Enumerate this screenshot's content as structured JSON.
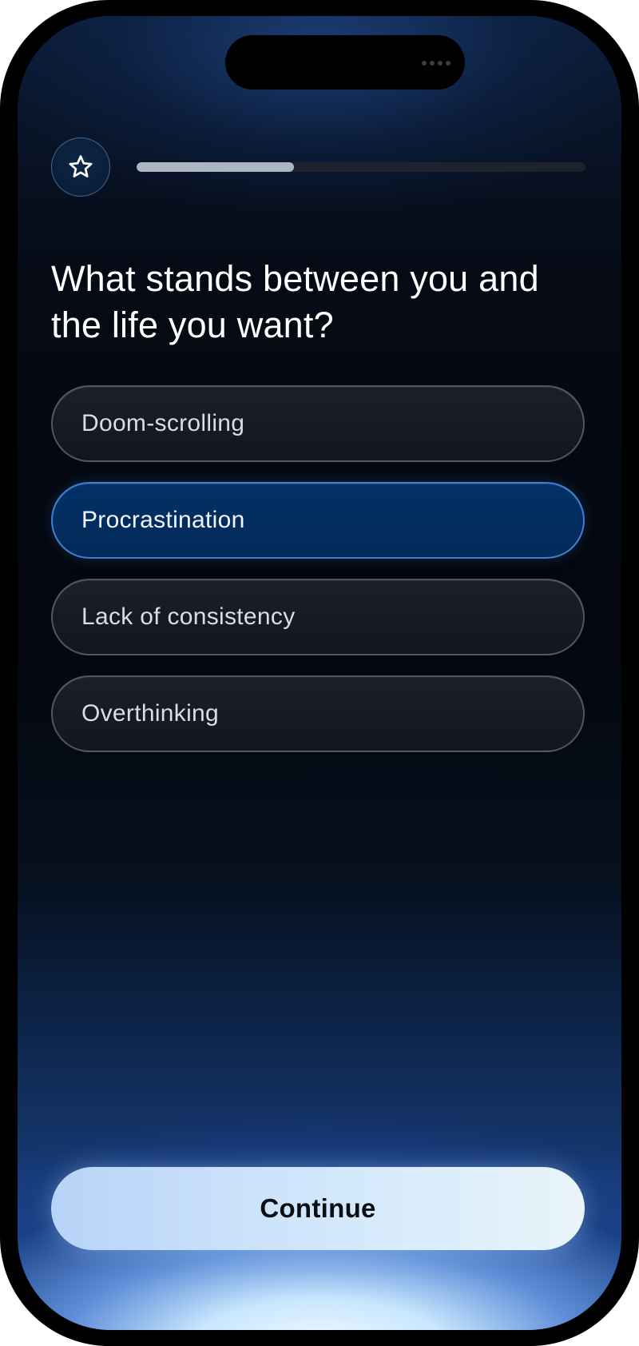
{
  "progress": {
    "fraction": 0.35
  },
  "header": {
    "badge_icon": "star-icon"
  },
  "question": {
    "text": "What stands between you and the life you want?"
  },
  "options": [
    {
      "label": "Doom-scrolling",
      "selected": false
    },
    {
      "label": "Procrastination",
      "selected": true
    },
    {
      "label": "Lack of consistency",
      "selected": false
    },
    {
      "label": "Overthinking",
      "selected": false
    }
  ],
  "footer": {
    "continue_label": "Continue"
  },
  "colors": {
    "selected_fill": "#032d5e",
    "selected_border": "#3f7fd0",
    "background": "#04070d",
    "button": "#cde3fb"
  }
}
